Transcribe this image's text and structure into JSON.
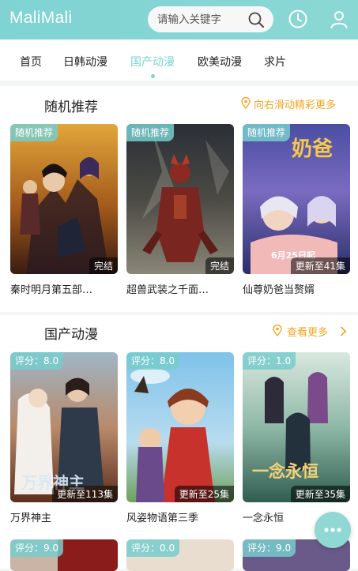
{
  "app": {
    "logo": "MaliMali"
  },
  "header": {
    "search_placeholder": "请输入关键字"
  },
  "nav": {
    "items": [
      {
        "label": "首页",
        "active": false
      },
      {
        "label": "日韩动漫",
        "active": false
      },
      {
        "label": "国产动漫",
        "active": true
      },
      {
        "label": "欧美动漫",
        "active": false
      },
      {
        "label": "求片",
        "active": false
      }
    ]
  },
  "random": {
    "title": "随机推荐",
    "more": "向右滑动精彩更多",
    "cards": [
      {
        "tag": "随机推荐",
        "status": "完结",
        "title": "秦时明月第五部…"
      },
      {
        "tag": "随机推荐",
        "status": "完结",
        "title": "超兽武装之千面…"
      },
      {
        "tag": "随机推荐",
        "status": "更新至41集",
        "poster_text": "6月25日起",
        "title": "仙尊奶爸当赘婿"
      }
    ]
  },
  "guochan": {
    "title": "国产动漫",
    "more": "查看更多",
    "cards": [
      {
        "tag": "评分：8.0",
        "status": "更新至113集",
        "title": "万界神主"
      },
      {
        "tag": "评分：8.0",
        "status": "更新至25集",
        "title": "风姿物语第三季"
      },
      {
        "tag": "评分：1.0",
        "status": "更新至35集",
        "title": "一念永恒"
      }
    ],
    "next_row": [
      {
        "tag": "评分：9.0"
      },
      {
        "tag": "评分：0.0"
      },
      {
        "tag": "评分：9.0"
      }
    ]
  },
  "colors": {
    "accent": "#7fd3d3",
    "more": "#f5a623"
  }
}
